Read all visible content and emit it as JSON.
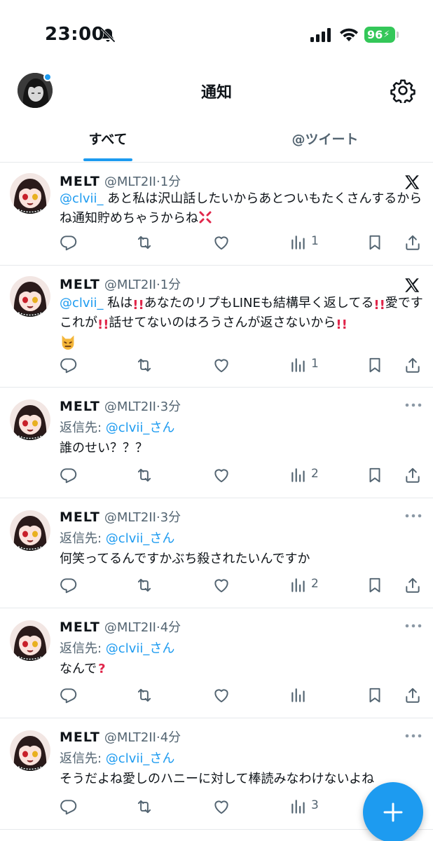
{
  "status_bar": {
    "time": "23:00",
    "battery": "96"
  },
  "header": {
    "title": "通知"
  },
  "tabs": [
    {
      "label": "すべて"
    },
    {
      "label": "@ツイート"
    }
  ],
  "tweets": [
    {
      "name": "MELT",
      "handle": "@MLT2II",
      "sep": "·",
      "time": "1分",
      "mention": "@clvii_",
      "text1": " あと私は沢山話したいからあとついもたくさんするからね通知貯めちゃうからね",
      "views": "1"
    },
    {
      "name": "MELT",
      "handle": "@MLT2II",
      "sep": "·",
      "time": "1分",
      "mention": "@clvii_",
      "p1": " 私は",
      "p2": "あなたのリプもLINEも結構早く返してる",
      "p3": "愛ですこれが",
      "p4": "話せてないのはろうさんが返さないから",
      "views": "1"
    },
    {
      "name": "MELT",
      "handle": "@MLT2II",
      "sep": "·",
      "time": "3分",
      "reply_prefix": "返信先: ",
      "reply_handle": "@clvii_さん",
      "text": "誰のせい？？？",
      "views": "2"
    },
    {
      "name": "MELT",
      "handle": "@MLT2II",
      "sep": "·",
      "time": "3分",
      "reply_prefix": "返信先: ",
      "reply_handle": "@clvii_さん",
      "text": "何笑ってるんですかぶち殺されたいんですか",
      "views": "2"
    },
    {
      "name": "MELT",
      "handle": "@MLT2II",
      "sep": "·",
      "time": "4分",
      "reply_prefix": "返信先: ",
      "reply_handle": "@clvii_さん",
      "text": "なんで",
      "views": ""
    },
    {
      "name": "MELT",
      "handle": "@MLT2II",
      "sep": "·",
      "time": "4分",
      "reply_prefix": "返信先: ",
      "reply_handle": "@clvii_さん",
      "text": "そうだよね愛しのハニーに対して棒読みなわけないよね",
      "views": "3"
    }
  ],
  "colors": {
    "accent": "#1d9bf0",
    "secondary_text": "#536471",
    "battery": "#34c759"
  },
  "icons": [
    "bell-slash-icon",
    "signal-icon",
    "wifi-icon",
    "gear-icon",
    "x-logo-icon",
    "more-icon",
    "reply-icon",
    "retweet-icon",
    "like-icon",
    "views-icon",
    "bookmark-icon",
    "share-icon",
    "plus-icon"
  ]
}
